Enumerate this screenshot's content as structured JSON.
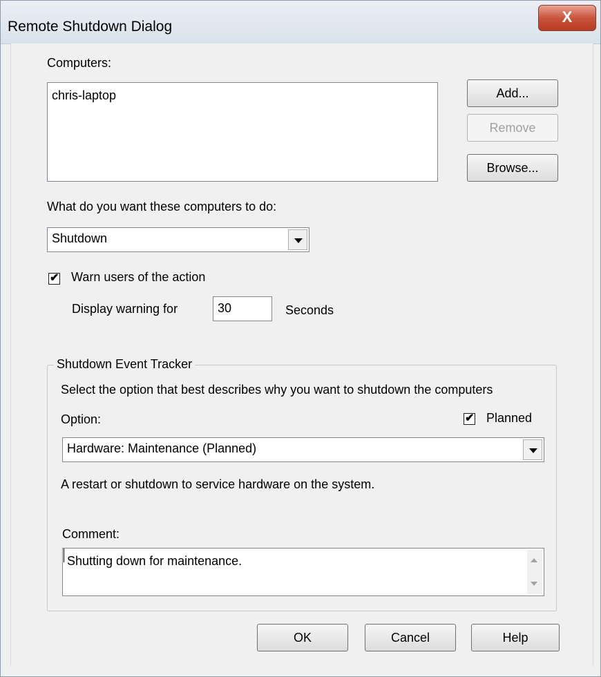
{
  "window": {
    "title": "Remote Shutdown Dialog",
    "close_label": "X"
  },
  "computers": {
    "label": "Computers:",
    "items": [
      "chris-laptop"
    ],
    "add_button": "Add...",
    "remove_button": "Remove",
    "browse_button": "Browse..."
  },
  "action": {
    "label": "What do you want these computers to do:",
    "selected": "Shutdown"
  },
  "warn": {
    "checkbox_label": "Warn users of the action",
    "checked": true,
    "display_label": "Display warning for",
    "seconds_value": "30",
    "seconds_unit": "Seconds"
  },
  "tracker": {
    "legend": "Shutdown Event Tracker",
    "description": "Select the option that best describes why you want to shutdown the computers",
    "option_label": "Option:",
    "planned_label": "Planned",
    "planned_checked": true,
    "option_selected": "Hardware: Maintenance (Planned)",
    "option_description": "A restart or shutdown to service hardware on the system.",
    "comment_label": "Comment:",
    "comment_value": "Shutting down for maintenance."
  },
  "footer": {
    "ok": "OK",
    "cancel": "Cancel",
    "help": "Help"
  }
}
